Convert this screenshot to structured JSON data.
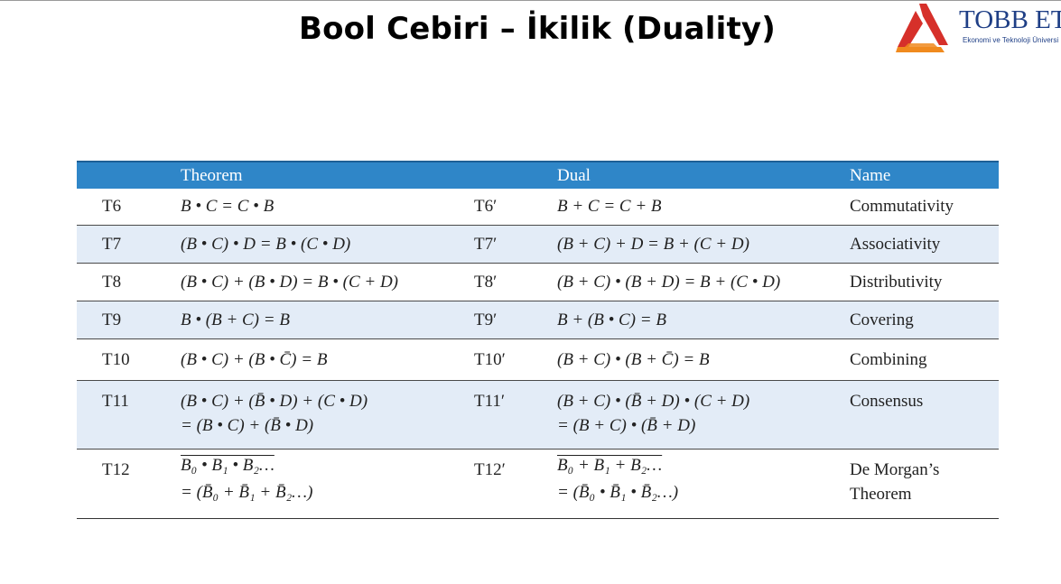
{
  "slide": {
    "title": "Bool Cebiri – İkilik (Duality)"
  },
  "logo": {
    "name": "TOBB ET",
    "subtitle": "Ekonomi ve Teknoloji Üniversi",
    "colors": {
      "red": "#d6302a",
      "orange": "#f08a1e",
      "navy": "#1f3f86"
    }
  },
  "table": {
    "header_color": "#2f86c8",
    "headers": {
      "theorem": "Theorem",
      "dual": "Dual",
      "name": "Name"
    },
    "rows": [
      {
        "id": "T6",
        "theorem": [
          "B • C = C • B"
        ],
        "dual_id": "T6′",
        "dual": [
          "B + C = C + B"
        ],
        "name": [
          "Commutativity"
        ]
      },
      {
        "id": "T7",
        "theorem": [
          "(B • C) • D = B • (C • D)"
        ],
        "dual_id": "T7′",
        "dual": [
          "(B + C) + D = B + (C + D)"
        ],
        "name": [
          "Associativity"
        ]
      },
      {
        "id": "T8",
        "theorem": [
          "(B • C) + (B • D) = B • (C + D)"
        ],
        "dual_id": "T8′",
        "dual": [
          "(B + C) • (B + D) = B + (C • D)"
        ],
        "name": [
          "Distributivity"
        ]
      },
      {
        "id": "T9",
        "theorem": [
          "B • (B + C) = B"
        ],
        "dual_id": "T9′",
        "dual": [
          "B + (B • C) = B"
        ],
        "name": [
          "Covering"
        ]
      },
      {
        "id": "T10",
        "theorem": [
          "(B • C) + (B • C̄) = B"
        ],
        "dual_id": "T10′",
        "dual": [
          "(B + C) • (B + C̄) = B"
        ],
        "name": [
          "Combining"
        ]
      },
      {
        "id": "T11",
        "theorem": [
          "(B • C) + (B̄ • D) + (C • D)",
          "= (B • C) + (B̄ • D)"
        ],
        "dual_id": "T11′",
        "dual": [
          "(B + C) • (B̄ + D) • (C + D)",
          "= (B + C) • (B̄ + D)"
        ],
        "name": [
          "Consensus"
        ]
      },
      {
        "id": "T12",
        "theorem": [
          "B₀ • B₁ • B₂…",
          "= (B̄₀ + B̄₁ + B̄₂…)"
        ],
        "dual_id": "T12′",
        "dual": [
          "B₀ + B₁ + B₂…",
          "= (B̄₀ • B̄₁ • B̄₂…)"
        ],
        "name": [
          "De Morgan’s",
          "Theorem"
        ]
      }
    ]
  }
}
